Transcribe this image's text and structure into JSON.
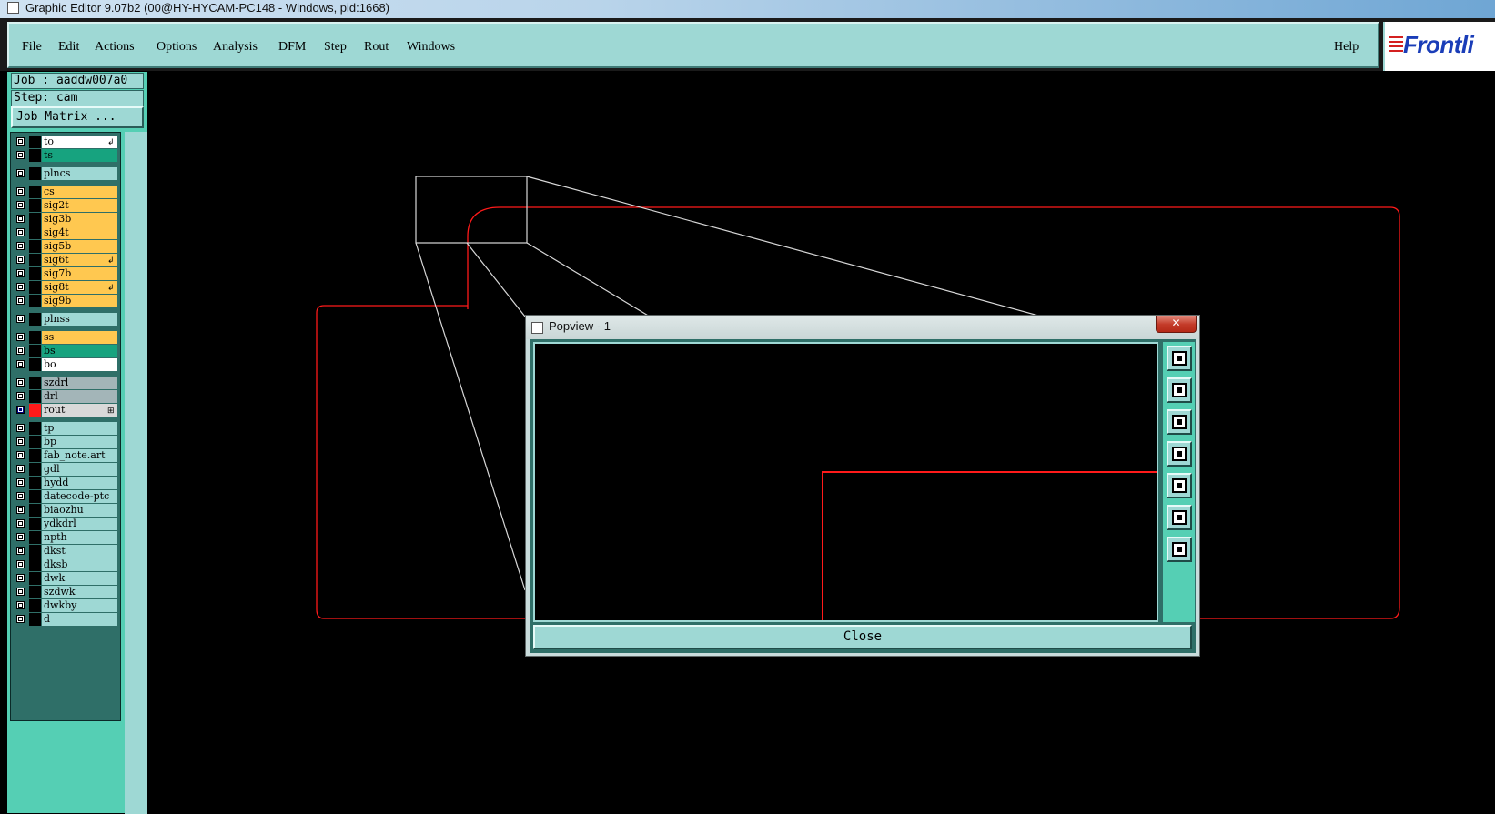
{
  "window": {
    "title": "Graphic Editor 9.07b2 (00@HY-HYCAM-PC148 - Windows, pid:1668)"
  },
  "menubar": {
    "items": [
      {
        "label": "File"
      },
      {
        "label": "Edit"
      },
      {
        "label": "Actions"
      },
      {
        "label": "Options"
      },
      {
        "label": "Analysis"
      },
      {
        "label": "DFM"
      },
      {
        "label": "Step"
      },
      {
        "label": "Rout"
      },
      {
        "label": "Windows"
      }
    ],
    "help": "Help",
    "logo": "Frontli"
  },
  "left_panel": {
    "job": "Job : aaddw007a0",
    "step": "Step: cam",
    "job_matrix": "Job Matrix ...",
    "layers": [
      {
        "name": "to",
        "color": "#ffffff",
        "mark": "↲"
      },
      {
        "name": "ts",
        "color": "#17a37f",
        "mark": ""
      },
      {
        "name": "plncs",
        "color": "#9ed8d4",
        "mark": ""
      },
      {
        "name": "cs",
        "color": "#ffc850",
        "mark": ""
      },
      {
        "name": "sig2t",
        "color": "#ffc850",
        "mark": ""
      },
      {
        "name": "sig3b",
        "color": "#ffc850",
        "mark": ""
      },
      {
        "name": "sig4t",
        "color": "#ffc850",
        "mark": ""
      },
      {
        "name": "sig5b",
        "color": "#ffc850",
        "mark": ""
      },
      {
        "name": "sig6t",
        "color": "#ffc850",
        "mark": "↲"
      },
      {
        "name": "sig7b",
        "color": "#ffc850",
        "mark": ""
      },
      {
        "name": "sig8t",
        "color": "#ffc850",
        "mark": "↲"
      },
      {
        "name": "sig9b",
        "color": "#ffc850",
        "mark": ""
      },
      {
        "name": "plnss",
        "color": "#9ed8d4",
        "mark": ""
      },
      {
        "name": "ss",
        "color": "#ffc850",
        "mark": ""
      },
      {
        "name": "bs",
        "color": "#17a37f",
        "mark": ""
      },
      {
        "name": "bo",
        "color": "#ffffff",
        "mark": ""
      },
      {
        "name": "szdrl",
        "color": "#a3b5b8",
        "mark": ""
      },
      {
        "name": "drl",
        "color": "#a3b5b8",
        "mark": ""
      },
      {
        "name": "rout",
        "color": "#d9d9d9",
        "mark": "⊞",
        "active": true
      },
      {
        "name": "tp",
        "color": "#9ed8d4",
        "mark": ""
      },
      {
        "name": "bp",
        "color": "#9ed8d4",
        "mark": ""
      },
      {
        "name": "fab_note.art",
        "color": "#9ed8d4",
        "mark": ""
      },
      {
        "name": "gdl",
        "color": "#9ed8d4",
        "mark": ""
      },
      {
        "name": "hydd",
        "color": "#9ed8d4",
        "mark": ""
      },
      {
        "name": "datecode-ptc",
        "color": "#9ed8d4",
        "mark": ""
      },
      {
        "name": "biaozhu",
        "color": "#9ed8d4",
        "mark": ""
      },
      {
        "name": "ydkdrl",
        "color": "#9ed8d4",
        "mark": ""
      },
      {
        "name": "npth",
        "color": "#9ed8d4",
        "mark": ""
      },
      {
        "name": "dkst",
        "color": "#9ed8d4",
        "mark": ""
      },
      {
        "name": "dksb",
        "color": "#9ed8d4",
        "mark": ""
      },
      {
        "name": "dwk",
        "color": "#9ed8d4",
        "mark": ""
      },
      {
        "name": "szdwk",
        "color": "#9ed8d4",
        "mark": ""
      },
      {
        "name": "dwkby",
        "color": "#9ed8d4",
        "mark": ""
      },
      {
        "name": "d",
        "color": "#9ed8d4",
        "mark": ""
      }
    ]
  },
  "popview": {
    "title": "Popview - 1",
    "close_x": "✕",
    "close_label": "Close",
    "tools": [
      "zoom-window-icon",
      "pan-up-icon",
      "pan-down-icon",
      "pan-left-icon",
      "pan-right-icon",
      "zoom-fit-icon",
      "zoom-home-icon"
    ]
  },
  "colors": {
    "panel": "#55cfb4",
    "menubar": "#9ed8d4",
    "profile": "#ff1a1a",
    "canvas": "#000000"
  }
}
